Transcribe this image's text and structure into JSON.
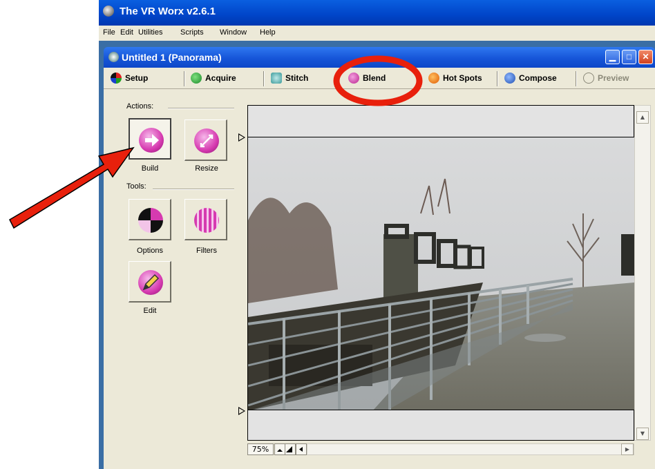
{
  "app": {
    "title": "The VR Worx v2.6.1"
  },
  "menu": [
    "File",
    "Edit",
    "Utilities",
    "Scripts",
    "Window",
    "Help"
  ],
  "document": {
    "title": "Untitled 1 (Panorama)"
  },
  "tabs": [
    {
      "label": "Setup"
    },
    {
      "label": "Acquire"
    },
    {
      "label": "Stitch"
    },
    {
      "label": "Blend"
    },
    {
      "label": "Hot Spots"
    },
    {
      "label": "Compose"
    },
    {
      "label": "Preview"
    }
  ],
  "active_tab": "Blend",
  "actions": {
    "label": "Actions:",
    "build": "Build",
    "resize": "Resize"
  },
  "tools": {
    "label": "Tools:",
    "options": "Options",
    "filters": "Filters",
    "edit": "Edit"
  },
  "zoom": "75%",
  "colors": {
    "annotation": "#e8200c",
    "accent_pink": "#d63ab0",
    "titlebar": "#0a5fe0"
  }
}
